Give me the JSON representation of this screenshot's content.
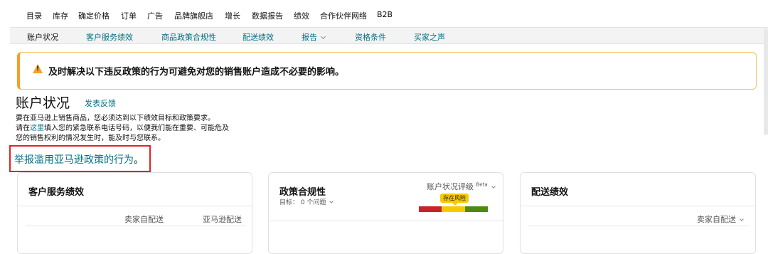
{
  "top_nav": [
    "目录",
    "库存",
    "确定价格",
    "订单",
    "广告",
    "品牌旗舰店",
    "增长",
    "数据报告",
    "绩效",
    "合作伙伴网络",
    "B2B"
  ],
  "sub_nav": [
    "账户状况",
    "客户服务绩效",
    "商品政策合规性",
    "配送绩效",
    "报告",
    "资格条件",
    "买家之声"
  ],
  "alert": {
    "text": "及时解决以下违反政策的行为可避免对您的销售账户造成不必要的影响。"
  },
  "page": {
    "title": "账户状况",
    "feedback_link": "发表反馈",
    "desc_line1": "要在亚马逊上销售商品，您必须达到以下绩效目标和政策要求。",
    "desc_line2_prefix": "请在",
    "desc_line2_link": "这里",
    "desc_line2_suffix": "填入您的紧急联系电话号码，以便我们能在重要、可能危及",
    "desc_line3": "您的销售权利的情况发生时，能及时与您联系。",
    "report_link": "举报滥用亚马逊政策的行为",
    "report_period": "。"
  },
  "cards": {
    "customer_service": {
      "title": "客户服务绩效",
      "col1": "卖家自配送",
      "col2": "亚马逊配送"
    },
    "policy": {
      "title": "政策合规性",
      "target": "目标： 0 个问题",
      "rating_label": "账户状况评级",
      "beta": "Beta",
      "risk_badge": "存在风险"
    },
    "shipping": {
      "title": "配送绩效",
      "col1": "卖家自配送"
    }
  },
  "colors": {
    "link": "#007185",
    "alert_border": "#f5c36a",
    "warning": "#f0a22c",
    "bar_red": "#c7242a",
    "bar_yellow": "#f7ca00",
    "bar_green": "#4f8a10",
    "highlight_box": "#e02424"
  }
}
